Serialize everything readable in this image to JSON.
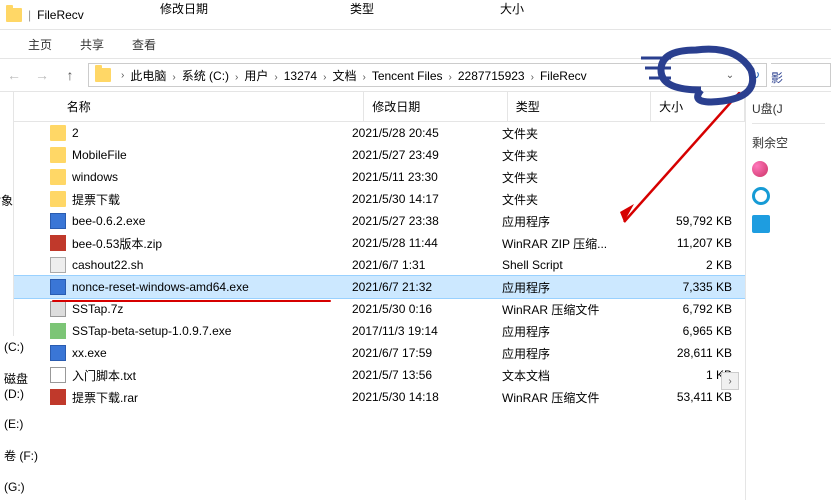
{
  "window": {
    "title": "FileRecv"
  },
  "menu": {
    "home": "主页",
    "share": "共享",
    "view": "查看"
  },
  "breadcrumb": [
    "此电脑",
    "系统 (C:)",
    "用户",
    "13274",
    "文档",
    "Tencent Files",
    "2287715923",
    "FileRecv"
  ],
  "headers": {
    "name": "名称",
    "date": "修改日期",
    "type": "类型",
    "size": "大小"
  },
  "top_headers": {
    "date": "修改日期",
    "type": "类型",
    "size": "大小"
  },
  "files": [
    {
      "icon": "fd",
      "name": "2",
      "date": "2021/5/28 20:45",
      "type": "文件夹",
      "size": ""
    },
    {
      "icon": "fd",
      "name": "MobileFile",
      "date": "2021/5/27 23:49",
      "type": "文件夹",
      "size": ""
    },
    {
      "icon": "fd",
      "name": "windows",
      "date": "2021/5/11 23:30",
      "type": "文件夹",
      "size": ""
    },
    {
      "icon": "fd",
      "name": "提票下载",
      "date": "2021/5/30 14:17",
      "type": "文件夹",
      "size": ""
    },
    {
      "icon": "exe",
      "name": "bee-0.6.2.exe",
      "date": "2021/5/27 23:38",
      "type": "应用程序",
      "size": "59,792 KB"
    },
    {
      "icon": "rar",
      "name": "bee-0.53版本.zip",
      "date": "2021/5/28 11:44",
      "type": "WinRAR ZIP 压缩...",
      "size": "11,207 KB"
    },
    {
      "icon": "sh",
      "name": "cashout22.sh",
      "date": "2021/6/7 1:31",
      "type": "Shell Script",
      "size": "2 KB"
    },
    {
      "icon": "exe",
      "name": "nonce-reset-windows-amd64.exe",
      "date": "2021/6/7 21:32",
      "type": "应用程序",
      "size": "7,335 KB",
      "selected": true
    },
    {
      "icon": "z7",
      "name": "SSTap.7z",
      "date": "2021/5/30 0:16",
      "type": "WinRAR 压缩文件",
      "size": "6,792 KB"
    },
    {
      "icon": "st",
      "name": "SSTap-beta-setup-1.0.9.7.exe",
      "date": "2017/11/3 19:14",
      "type": "应用程序",
      "size": "6,965 KB"
    },
    {
      "icon": "exe",
      "name": "xx.exe",
      "date": "2021/6/7 17:59",
      "type": "应用程序",
      "size": "28,611 KB"
    },
    {
      "icon": "txt",
      "name": "入门脚本.txt",
      "date": "2021/5/7 13:56",
      "type": "文本文档",
      "size": "1 KB"
    },
    {
      "icon": "rar",
      "name": "提票下载.rar",
      "date": "2021/5/30 14:18",
      "type": "WinRAR 压缩文件",
      "size": "53,411 KB"
    }
  ],
  "side": {
    "usb": "U盘(J",
    "remain": "剩余空"
  },
  "left_labels": [
    "",
    "对象"
  ],
  "drives": [
    "(C:)",
    "磁盘 (D:)",
    "(E:)",
    "卷 (F:)",
    "(G:)"
  ],
  "logo_text": "影"
}
